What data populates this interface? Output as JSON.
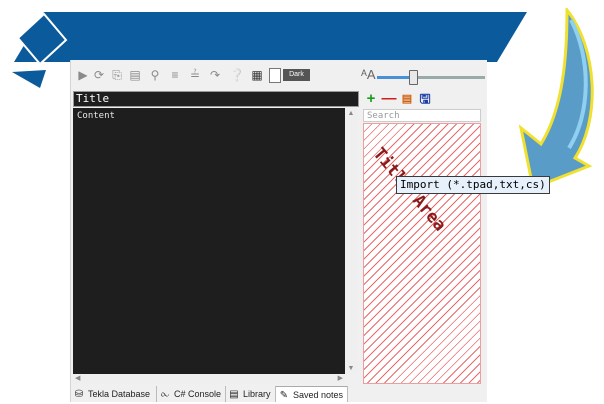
{
  "toolbar": {
    "icons": [
      "play-icon",
      "refresh-icon",
      "paste-icon",
      "list-icon",
      "find-icon",
      "outdent-icon",
      "indent-icon",
      "redirect-icon",
      "help-icon",
      "console-icon"
    ],
    "dark_label": "Dark",
    "font_size_label": "ᴬA",
    "zoom": 0.3
  },
  "editor": {
    "title": "Title",
    "content": "Content"
  },
  "notes_pane": {
    "search_placeholder": "Search",
    "title_area_label": "Title Area"
  },
  "tooltip": "Import (*.tpad,txt,cs)",
  "tabs": [
    {
      "label": "Tekla Database",
      "icon": "database-icon"
    },
    {
      "label": "C# Console",
      "icon": "visual-studio-icon"
    },
    {
      "label": "Library",
      "icon": "library-icon"
    },
    {
      "label": "Saved notes",
      "icon": "pen-icon",
      "active": true
    }
  ],
  "colors": {
    "banner": "#0a5a9c",
    "arrow": "#f0e030",
    "editor_bg": "#1e1e1e",
    "hatch": "#e86a6a"
  }
}
